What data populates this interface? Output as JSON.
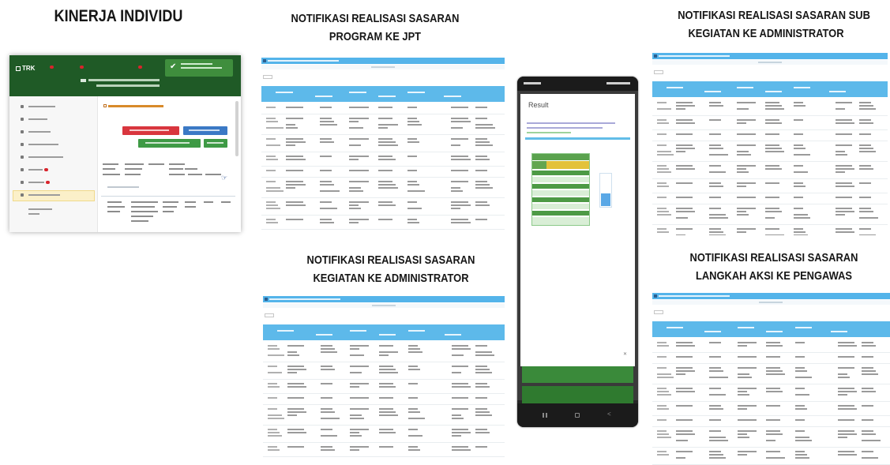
{
  "headings": {
    "kinerja": "KINERJA INDIVIDU",
    "program": [
      "NOTIFIKASI REALISASI SASARAN",
      "PROGRAM KE JPT"
    ],
    "subkegiatan": [
      "NOTIFIKASI REALISASI SASARAN SUB",
      "KEGIATAN KE ADMINISTRATOR"
    ],
    "kegiatan": [
      "NOTIFIKASI REALISASI SASARAN",
      "KEGIATAN KE ADMINISTRATOR"
    ],
    "langkah": [
      "NOTIFIKASI REALISASI SASARAN",
      "LANGKAH AKSI KE PENGAWAS"
    ]
  },
  "app": {
    "brand": "TRK",
    "header_color": "#1f5a26",
    "icons": [
      "check-icon",
      "cursor-icon"
    ]
  },
  "phone": {
    "dialog_title": "Result"
  },
  "colors": {
    "report_blue": "#54b4ea",
    "header_green": "#1f5a26",
    "button_red": "#d9363e",
    "button_blue": "#3b79c5",
    "button_green": "#3e9a45"
  }
}
